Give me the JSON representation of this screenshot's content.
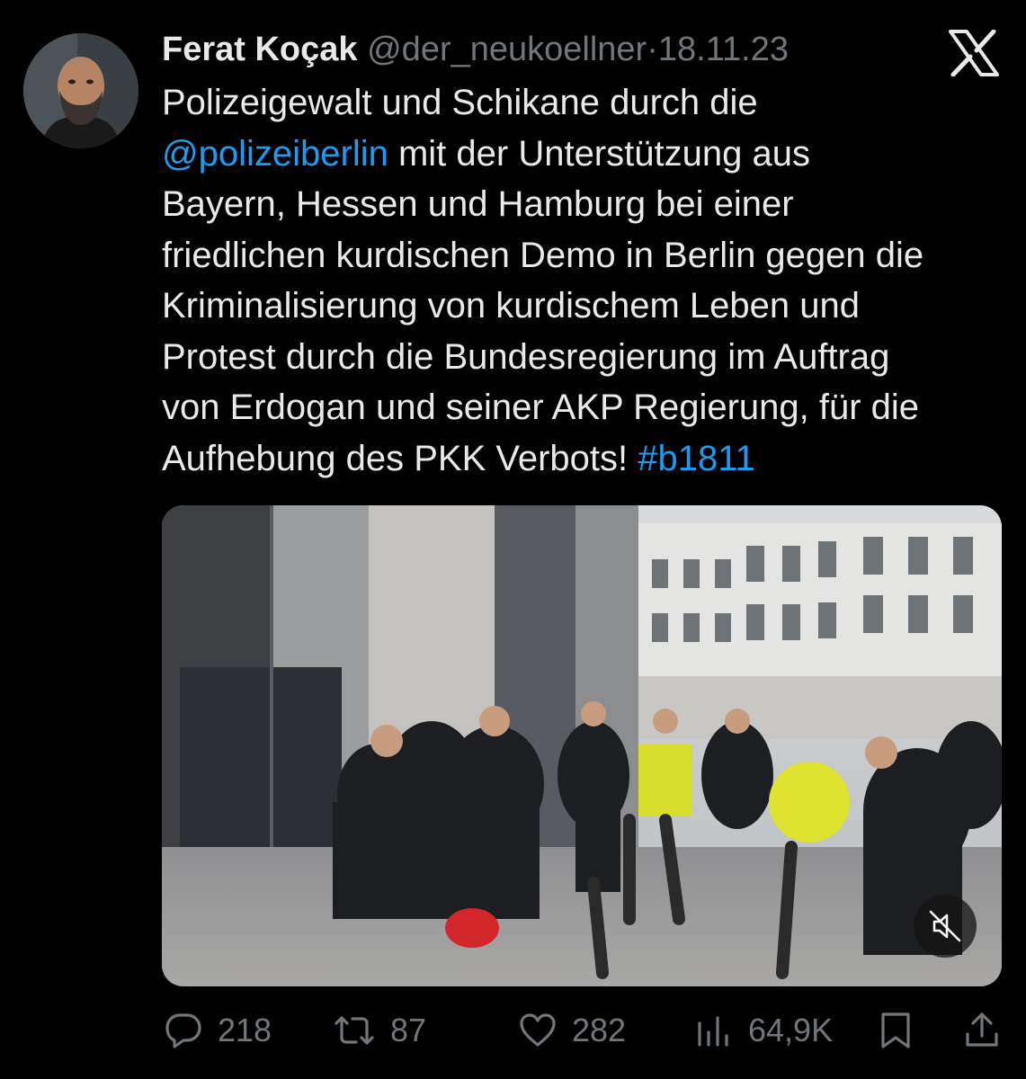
{
  "tweet": {
    "author_name": "Ferat Koçak",
    "author_handle": "@der_neukoellner",
    "separator": "·",
    "date": "18.11.23",
    "text_lines": [
      {
        "parts": [
          {
            "text": "Polizeigewalt und Schikane durch die",
            "link": false
          }
        ]
      },
      {
        "parts": [
          {
            "text": "@polizeiberlin",
            "link": true
          },
          {
            "text": " mit der Unterstützung aus",
            "link": false
          }
        ]
      },
      {
        "parts": [
          {
            "text": "Bayern, Hessen und Hamburg bei einer",
            "link": false
          }
        ]
      },
      {
        "parts": [
          {
            "text": "friedlichen kurdischen Demo in Berlin gegen die",
            "link": false
          }
        ]
      },
      {
        "parts": [
          {
            "text": "Kriminalisierung von kurdischem Leben und",
            "link": false
          }
        ]
      },
      {
        "parts": [
          {
            "text": "Protest durch die Bundesregierung im Auftrag",
            "link": false
          }
        ]
      },
      {
        "parts": [
          {
            "text": "von Erdogan und seiner AKP Regierung, für die",
            "link": false
          }
        ]
      },
      {
        "parts": [
          {
            "text": "Aufhebung des PKK Verbots! ",
            "link": false
          },
          {
            "text": "#b1811",
            "link": true
          }
        ]
      }
    ]
  },
  "media": {
    "type": "video",
    "muted": true,
    "mute_icon": "speaker-muted-icon"
  },
  "actions": {
    "replies": "218",
    "reposts": "87",
    "likes": "282",
    "views": "64,9K"
  },
  "icons": {
    "logo": "x-logo-icon",
    "reply": "reply-icon",
    "repost": "repost-icon",
    "like": "heart-icon",
    "views": "views-chart-icon",
    "bookmark": "bookmark-icon",
    "share": "share-icon"
  },
  "colors": {
    "background": "#000000",
    "text": "#e7e9ea",
    "secondary": "#71767b",
    "link": "#1d9bf0"
  }
}
